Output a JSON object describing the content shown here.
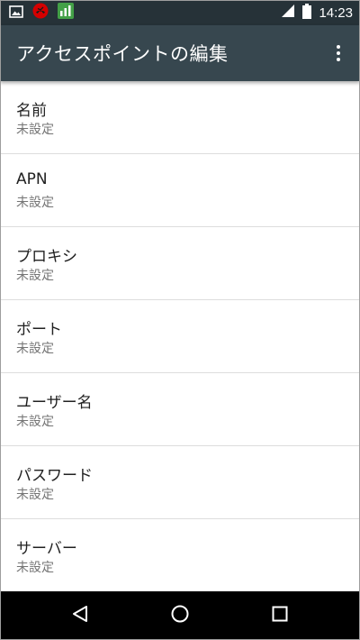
{
  "status_bar": {
    "time": "14:23",
    "icons": [
      "image-icon",
      "missed-call-icon",
      "bar-chart-icon",
      "signal-icon",
      "battery-icon"
    ]
  },
  "app_bar": {
    "title": "アクセスポイントの編集",
    "menu_icon": "more-vert-icon"
  },
  "list": {
    "items": [
      {
        "title": "名前",
        "summary": "未設定"
      },
      {
        "title": "APN",
        "summary": "未設定"
      },
      {
        "title": "プロキシ",
        "summary": "未設定"
      },
      {
        "title": "ポート",
        "summary": "未設定"
      },
      {
        "title": "ユーザー名",
        "summary": "未設定"
      },
      {
        "title": "パスワード",
        "summary": "未設定"
      },
      {
        "title": "サーバー",
        "summary": "未設定"
      }
    ]
  },
  "nav_bar": {
    "icons": [
      "back-icon",
      "home-icon",
      "recents-icon"
    ]
  },
  "colors": {
    "status_bar": "#263238",
    "app_bar": "#37474f",
    "nav_bar": "#000000",
    "missed_call_badge": "#d50000",
    "chart_badge": "#43a047"
  }
}
